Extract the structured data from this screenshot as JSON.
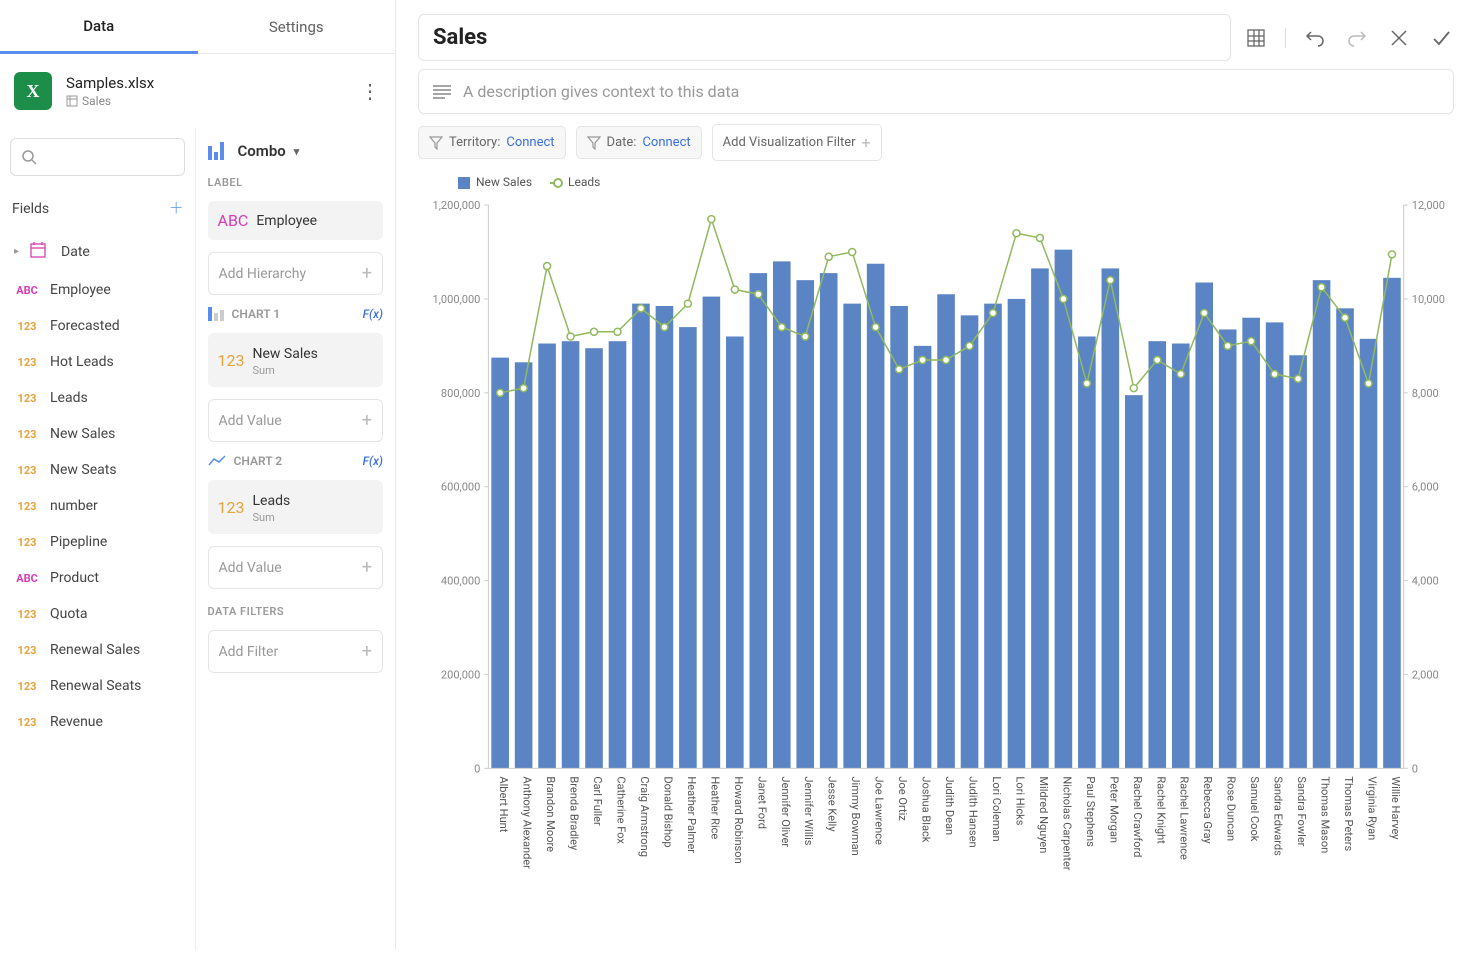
{
  "tabs": {
    "data": "Data",
    "settings": "Settings"
  },
  "file": {
    "name": "Samples.xlsx",
    "sheet": "Sales"
  },
  "search_placeholder": "",
  "fields_header": "Fields",
  "fields": [
    {
      "type": "date",
      "label": "Date"
    },
    {
      "type": "abc",
      "label": "Employee"
    },
    {
      "type": "123",
      "label": "Forecasted"
    },
    {
      "type": "123",
      "label": "Hot Leads"
    },
    {
      "type": "123",
      "label": "Leads"
    },
    {
      "type": "123",
      "label": "New Sales"
    },
    {
      "type": "123",
      "label": "New Seats"
    },
    {
      "type": "123",
      "label": "number"
    },
    {
      "type": "123",
      "label": "Pipepline"
    },
    {
      "type": "abc",
      "label": "Product"
    },
    {
      "type": "123",
      "label": "Quota"
    },
    {
      "type": "123",
      "label": "Renewal Sales"
    },
    {
      "type": "123",
      "label": "Renewal Seats"
    },
    {
      "type": "123",
      "label": "Revenue"
    }
  ],
  "config": {
    "type": "Combo",
    "label_section": "LABEL",
    "label_field": "Employee",
    "add_hierarchy": "Add Hierarchy",
    "chart1": {
      "title": "CHART 1",
      "fx": "F(x)",
      "field": "New Sales",
      "agg": "Sum",
      "add_value": "Add Value"
    },
    "chart2": {
      "title": "CHART 2",
      "fx": "F(x)",
      "field": "Leads",
      "agg": "Sum",
      "add_value": "Add Value"
    },
    "data_filters": "DATA FILTERS",
    "add_filter": "Add Filter"
  },
  "viz": {
    "title": "Sales",
    "description_placeholder": "A description gives context to this data",
    "filters": {
      "territory_label": "Territory:",
      "territory_action": "Connect",
      "date_label": "Date:",
      "date_action": "Connect",
      "add_viz_filter": "Add Visualization Filter"
    },
    "legend": {
      "bar": "New Sales",
      "line": "Leads"
    }
  },
  "chart_data": {
    "type": "combo",
    "categories": [
      "Albert Hunt",
      "Anthony Alexander",
      "Brandon Moore",
      "Brenda Bradley",
      "Carl Fuller",
      "Catherine Fox",
      "Craig Armstrong",
      "Donald Bishop",
      "Heather Palmer",
      "Heather Rice",
      "Howard Robinson",
      "Janet Ford",
      "Jennifer Oliver",
      "Jennifer Willis",
      "Jesse Kelly",
      "Jimmy Bowman",
      "Joe Lawrence",
      "Joe Ortiz",
      "Joshua Black",
      "Judith Dean",
      "Judith Hansen",
      "Lori Coleman",
      "Lori Hicks",
      "Mildred Nguyen",
      "Nicholas Carpenter",
      "Paul Stephens",
      "Peter Morgan",
      "Rachel Crawford",
      "Rachel Knight",
      "Rachel Lawrence",
      "Rebecca Gray",
      "Rose Duncan",
      "Samuel Cook",
      "Sandra Edwards",
      "Sandra Fowler",
      "Thomas Mason",
      "Thomas Peters",
      "Virginia Ryan",
      "Willie Harvey"
    ],
    "series": [
      {
        "name": "New Sales",
        "type": "bar",
        "axis": "left",
        "values": [
          875000,
          865000,
          905000,
          910000,
          895000,
          910000,
          990000,
          985000,
          940000,
          1005000,
          920000,
          1055000,
          1080000,
          1040000,
          1055000,
          990000,
          1075000,
          985000,
          900000,
          1010000,
          965000,
          990000,
          1000000,
          1065000,
          1105000,
          920000,
          1065000,
          795000,
          910000,
          905000,
          1035000,
          935000,
          960000,
          950000,
          880000,
          1040000,
          980000,
          915000,
          1045000
        ]
      },
      {
        "name": "Leads",
        "type": "line",
        "axis": "right",
        "values": [
          8000,
          8100,
          10700,
          9200,
          9300,
          9300,
          9800,
          9400,
          9900,
          11700,
          10200,
          10100,
          9400,
          9200,
          10900,
          11000,
          9400,
          8500,
          8700,
          8700,
          9000,
          9700,
          11400,
          11300,
          10000,
          8200,
          10400,
          8100,
          8700,
          8400,
          9700,
          9000,
          9100,
          8400,
          8300,
          10250,
          9600,
          8200,
          10950
        ]
      }
    ],
    "left_axis": {
      "min": 0,
      "max": 1200000,
      "ticks": [
        0,
        200000,
        400000,
        600000,
        800000,
        1000000,
        1200000
      ],
      "tick_labels": [
        "0",
        "200,000",
        "400,000",
        "600,000",
        "800,000",
        "1,000,000",
        "1,200,000"
      ]
    },
    "right_axis": {
      "min": 0,
      "max": 12000,
      "ticks": [
        0,
        2000,
        4000,
        6000,
        8000,
        10000,
        12000
      ],
      "tick_labels": [
        "0",
        "2,000",
        "4,000",
        "6,000",
        "8,000",
        "10,000",
        "12,000"
      ]
    }
  }
}
